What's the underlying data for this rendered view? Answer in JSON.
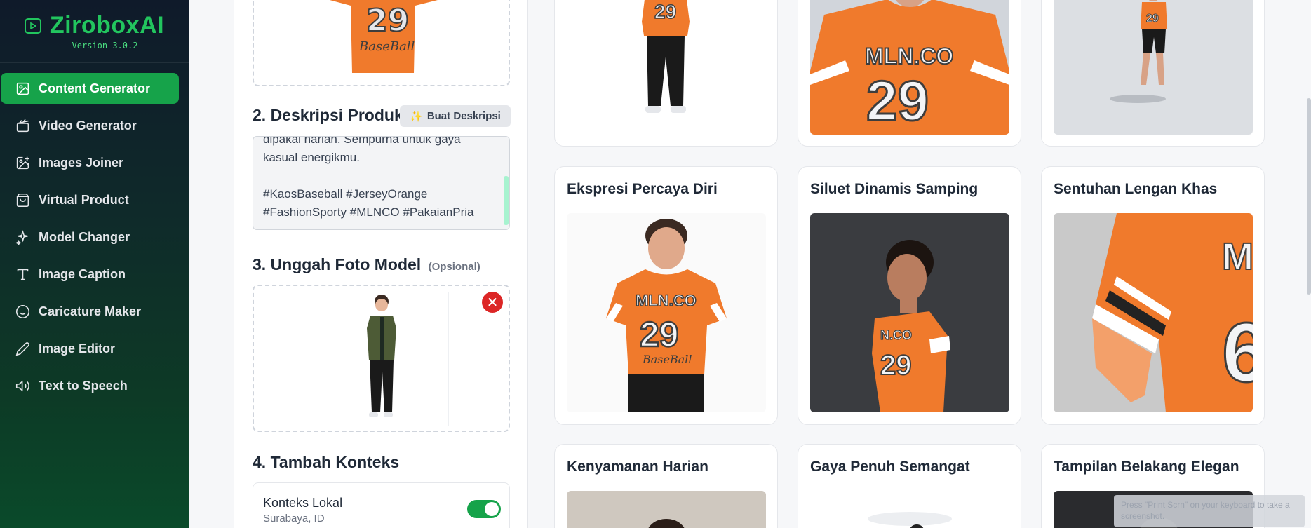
{
  "brand": {
    "title": "ZiroboxAI",
    "version": "Version 3.0.2"
  },
  "sidebar": {
    "items": [
      {
        "label": "Content Generator",
        "icon": "image-icon",
        "active": true
      },
      {
        "label": "Video Generator",
        "icon": "clapperboard-icon"
      },
      {
        "label": "Images Joiner",
        "icon": "image-plus-icon"
      },
      {
        "label": "Virtual Product",
        "icon": "shopping-bag-icon"
      },
      {
        "label": "Model Changer",
        "icon": "sparkles-icon"
      },
      {
        "label": "Image Caption",
        "icon": "type-icon"
      },
      {
        "label": "Caricature Maker",
        "icon": "smile-icon"
      },
      {
        "label": "Image Editor",
        "icon": "pencil-icon"
      },
      {
        "label": "Text to Speech",
        "icon": "speaker-icon"
      }
    ]
  },
  "form": {
    "desc_title": "2. Deskripsi Produk",
    "desc_button": "Buat Deskripsi",
    "desc_text": "dipakai harian. Sempurna untuk gaya\nkasual energikmu.\n\n#KaosBaseball #JerseyOrange\n#FashionSporty #MLNCO #PakaianPria",
    "model_title": "3. Unggah Foto Model",
    "model_optional": "(Opsional)",
    "remove_symbol": "✕",
    "context_title": "4. Tambah Konteks",
    "context_label": "Konteks Lokal",
    "context_value": "Surabaya, ID",
    "context_enabled": true
  },
  "results": {
    "cards": [
      {
        "title": "Ekspresi Percaya Diri"
      },
      {
        "title": "Siluet Dinamis Samping"
      },
      {
        "title": "Sentuhan Lengan Khas"
      },
      {
        "title": "Kenyamanan Harian"
      },
      {
        "title": "Gaya Penuh Semangat"
      },
      {
        "title": "Tampilan Belakang Elegan"
      }
    ]
  },
  "toast": {
    "text": "Press \"Print Scrn\" on your keyboard to take a screenshot."
  },
  "colors": {
    "accent": "#16a34a",
    "brand": "#22c55e",
    "shirt": "#f07a2c",
    "danger": "#dc2626"
  }
}
